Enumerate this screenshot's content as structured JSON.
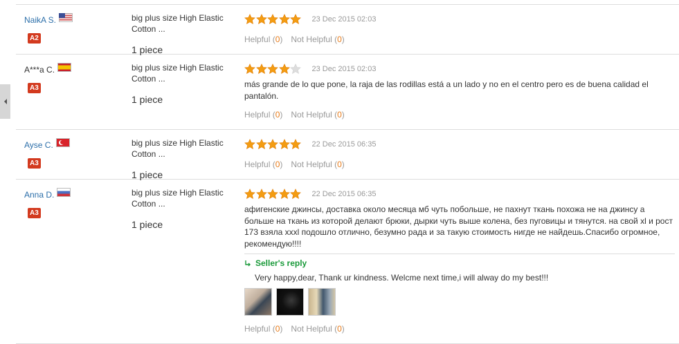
{
  "side_tab": {
    "icon": "caret-left-icon"
  },
  "labels": {
    "helpful": "Helpful",
    "not_helpful": "Not Helpful",
    "seller_reply": "Seller's reply"
  },
  "colors": {
    "link": "#2b6ea9",
    "star_on": "#f39c12",
    "star_off": "#dddddd",
    "badge": "#d33a1f",
    "seller_reply": "#1a9a3a",
    "count": "#e87c1a"
  },
  "reviews": [
    {
      "buyer": "NaikA S.",
      "flag": "us-flag-icon",
      "level": "A2",
      "product": "big plus size High Elastic Cotton ...",
      "quantity": "1 piece",
      "rating": 5,
      "date": "23 Dec 2015 02:03",
      "text": "",
      "helpful_count": "0",
      "not_helpful_count": "0"
    },
    {
      "buyer": "A***a C.",
      "flag": "es-flag-icon",
      "level": "A3",
      "product": "big plus size High Elastic Cotton ...",
      "quantity": "1 piece",
      "rating": 4,
      "date": "23 Dec 2015 02:03",
      "text": "más grande de lo que pone, la raja de las rodillas está a un lado y no en el centro pero es de buena calidad el pantalón.",
      "helpful_count": "0",
      "not_helpful_count": "0"
    },
    {
      "buyer": "Ayse C.",
      "flag": "tr-flag-icon",
      "level": "A3",
      "product": "big plus size High Elastic Cotton ...",
      "quantity": "1 piece",
      "rating": 5,
      "date": "22 Dec 2015 06:35",
      "text": "",
      "helpful_count": "0",
      "not_helpful_count": "0"
    },
    {
      "buyer": "Anna D.",
      "flag": "ru-flag-icon",
      "level": "A3",
      "product": "big plus size High Elastic Cotton ...",
      "quantity": "1 piece",
      "rating": 5,
      "date": "22 Dec 2015 06:35",
      "text": "афигенские джинсы, доставка около месяца мб чуть побольше, не пахнут ткань похожа не на джинсу а больше на ткань из которой делают брюки, дырки чуть выше колена, без пуговицы и тянутся. на свой xl и рост 173 взяла xxxl подошло отлично, безумно рада и за такую стоимость нигде не найдешь.Спасибо огромное, рекомендую!!!!",
      "seller_reply": "Very happy,dear, Thank ur kindness. Welcme next time,i will alway do my best!!!",
      "photos": [
        "photo-1",
        "photo-2",
        "photo-3"
      ],
      "helpful_count": "0",
      "not_helpful_count": "0"
    }
  ]
}
